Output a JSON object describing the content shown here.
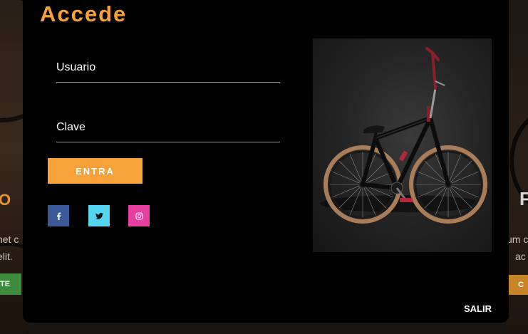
{
  "background": {
    "left_heading": "O",
    "left_text_line1": "net c",
    "left_text_line2": "elit.",
    "left_button": "TE",
    "right_heading": "F",
    "right_text_line1": "um c",
    "right_text_line2": "ac",
    "right_button": "C"
  },
  "login": {
    "title": "Accede",
    "username_placeholder": "Usuario",
    "username_value": "",
    "password_placeholder": "Clave",
    "password_value": "",
    "submit_label": "ENTRA",
    "close_label": "SALIR"
  },
  "social": [
    {
      "name": "facebook",
      "icon": "facebook-icon",
      "color": "#3b5998"
    },
    {
      "name": "twitter",
      "icon": "twitter-icon",
      "color": "#55d6f0"
    },
    {
      "name": "instagram",
      "icon": "instagram-icon",
      "color": "#e63fa0"
    }
  ],
  "colors": {
    "accent": "#f7a13a",
    "modal_bg": "#000000"
  }
}
